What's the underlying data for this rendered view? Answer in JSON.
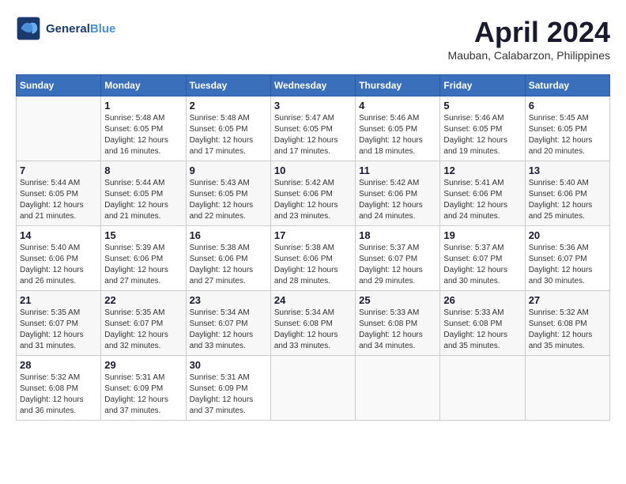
{
  "header": {
    "logo_line1": "General",
    "logo_line2": "Blue",
    "month_title": "April 2024",
    "location": "Mauban, Calabarzon, Philippines"
  },
  "days_of_week": [
    "Sunday",
    "Monday",
    "Tuesday",
    "Wednesday",
    "Thursday",
    "Friday",
    "Saturday"
  ],
  "weeks": [
    [
      {
        "day": "",
        "info": ""
      },
      {
        "day": "1",
        "info": "Sunrise: 5:48 AM\nSunset: 6:05 PM\nDaylight: 12 hours\nand 16 minutes."
      },
      {
        "day": "2",
        "info": "Sunrise: 5:48 AM\nSunset: 6:05 PM\nDaylight: 12 hours\nand 17 minutes."
      },
      {
        "day": "3",
        "info": "Sunrise: 5:47 AM\nSunset: 6:05 PM\nDaylight: 12 hours\nand 17 minutes."
      },
      {
        "day": "4",
        "info": "Sunrise: 5:46 AM\nSunset: 6:05 PM\nDaylight: 12 hours\nand 18 minutes."
      },
      {
        "day": "5",
        "info": "Sunrise: 5:46 AM\nSunset: 6:05 PM\nDaylight: 12 hours\nand 19 minutes."
      },
      {
        "day": "6",
        "info": "Sunrise: 5:45 AM\nSunset: 6:05 PM\nDaylight: 12 hours\nand 20 minutes."
      }
    ],
    [
      {
        "day": "7",
        "info": "Sunrise: 5:44 AM\nSunset: 6:05 PM\nDaylight: 12 hours\nand 21 minutes."
      },
      {
        "day": "8",
        "info": "Sunrise: 5:44 AM\nSunset: 6:05 PM\nDaylight: 12 hours\nand 21 minutes."
      },
      {
        "day": "9",
        "info": "Sunrise: 5:43 AM\nSunset: 6:05 PM\nDaylight: 12 hours\nand 22 minutes."
      },
      {
        "day": "10",
        "info": "Sunrise: 5:42 AM\nSunset: 6:06 PM\nDaylight: 12 hours\nand 23 minutes."
      },
      {
        "day": "11",
        "info": "Sunrise: 5:42 AM\nSunset: 6:06 PM\nDaylight: 12 hours\nand 24 minutes."
      },
      {
        "day": "12",
        "info": "Sunrise: 5:41 AM\nSunset: 6:06 PM\nDaylight: 12 hours\nand 24 minutes."
      },
      {
        "day": "13",
        "info": "Sunrise: 5:40 AM\nSunset: 6:06 PM\nDaylight: 12 hours\nand 25 minutes."
      }
    ],
    [
      {
        "day": "14",
        "info": "Sunrise: 5:40 AM\nSunset: 6:06 PM\nDaylight: 12 hours\nand 26 minutes."
      },
      {
        "day": "15",
        "info": "Sunrise: 5:39 AM\nSunset: 6:06 PM\nDaylight: 12 hours\nand 27 minutes."
      },
      {
        "day": "16",
        "info": "Sunrise: 5:38 AM\nSunset: 6:06 PM\nDaylight: 12 hours\nand 27 minutes."
      },
      {
        "day": "17",
        "info": "Sunrise: 5:38 AM\nSunset: 6:06 PM\nDaylight: 12 hours\nand 28 minutes."
      },
      {
        "day": "18",
        "info": "Sunrise: 5:37 AM\nSunset: 6:07 PM\nDaylight: 12 hours\nand 29 minutes."
      },
      {
        "day": "19",
        "info": "Sunrise: 5:37 AM\nSunset: 6:07 PM\nDaylight: 12 hours\nand 30 minutes."
      },
      {
        "day": "20",
        "info": "Sunrise: 5:36 AM\nSunset: 6:07 PM\nDaylight: 12 hours\nand 30 minutes."
      }
    ],
    [
      {
        "day": "21",
        "info": "Sunrise: 5:35 AM\nSunset: 6:07 PM\nDaylight: 12 hours\nand 31 minutes."
      },
      {
        "day": "22",
        "info": "Sunrise: 5:35 AM\nSunset: 6:07 PM\nDaylight: 12 hours\nand 32 minutes."
      },
      {
        "day": "23",
        "info": "Sunrise: 5:34 AM\nSunset: 6:07 PM\nDaylight: 12 hours\nand 33 minutes."
      },
      {
        "day": "24",
        "info": "Sunrise: 5:34 AM\nSunset: 6:08 PM\nDaylight: 12 hours\nand 33 minutes."
      },
      {
        "day": "25",
        "info": "Sunrise: 5:33 AM\nSunset: 6:08 PM\nDaylight: 12 hours\nand 34 minutes."
      },
      {
        "day": "26",
        "info": "Sunrise: 5:33 AM\nSunset: 6:08 PM\nDaylight: 12 hours\nand 35 minutes."
      },
      {
        "day": "27",
        "info": "Sunrise: 5:32 AM\nSunset: 6:08 PM\nDaylight: 12 hours\nand 35 minutes."
      }
    ],
    [
      {
        "day": "28",
        "info": "Sunrise: 5:32 AM\nSunset: 6:08 PM\nDaylight: 12 hours\nand 36 minutes."
      },
      {
        "day": "29",
        "info": "Sunrise: 5:31 AM\nSunset: 6:09 PM\nDaylight: 12 hours\nand 37 minutes."
      },
      {
        "day": "30",
        "info": "Sunrise: 5:31 AM\nSunset: 6:09 PM\nDaylight: 12 hours\nand 37 minutes."
      },
      {
        "day": "",
        "info": ""
      },
      {
        "day": "",
        "info": ""
      },
      {
        "day": "",
        "info": ""
      },
      {
        "day": "",
        "info": ""
      }
    ]
  ]
}
